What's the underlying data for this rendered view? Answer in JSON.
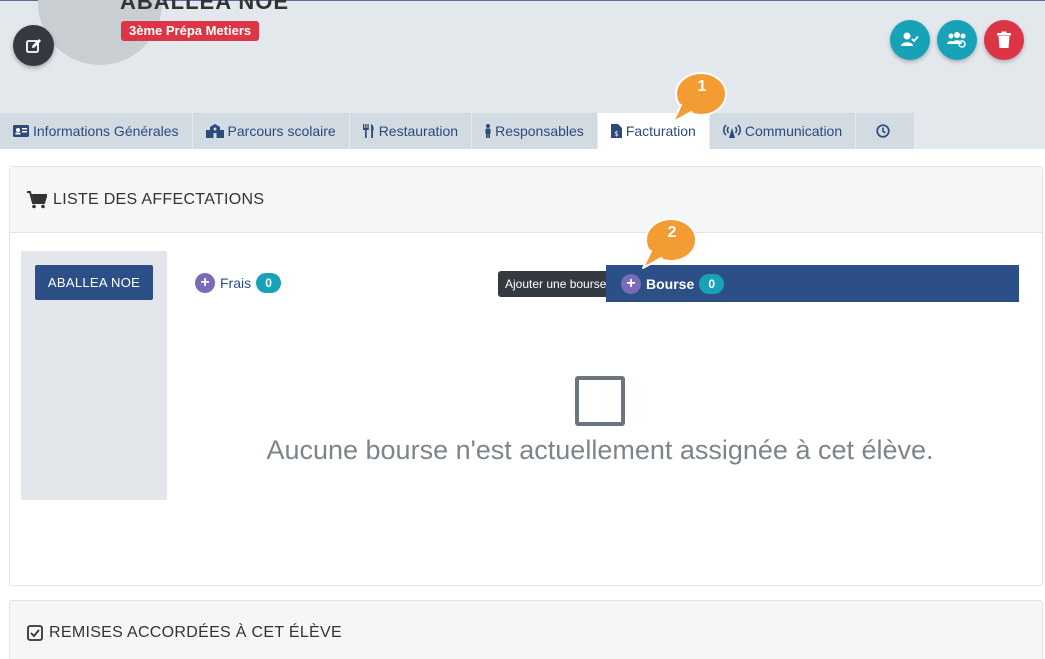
{
  "student": {
    "name": "ABALLEA NOE",
    "class_badge": "3ème Prépa Metiers"
  },
  "tabs": [
    {
      "label": "Informations Générales"
    },
    {
      "label": "Parcours scolaire"
    },
    {
      "label": "Restauration"
    },
    {
      "label": "Responsables"
    },
    {
      "label": "Facturation"
    },
    {
      "label": "Communication"
    },
    {
      "label": ""
    }
  ],
  "callouts": [
    "1",
    "2"
  ],
  "affectations": {
    "title": "LISTE DES AFFECTATIONS",
    "student_button": "ABALLEA NOE",
    "frais_label": "Frais",
    "frais_count": "0",
    "tooltip": "Ajouter une bourse",
    "bourse_label": "Bourse",
    "bourse_count": "0",
    "empty_message": "Aucune bourse n'est actuellement assignée à cet élève."
  },
  "remises": {
    "title": "REMISES ACCORDÉES À CET ÉLÈVE"
  },
  "colors": {
    "primary": "#2c4f87",
    "info": "#17a2b8",
    "danger": "#dc3545",
    "callout": "#f39c34"
  }
}
